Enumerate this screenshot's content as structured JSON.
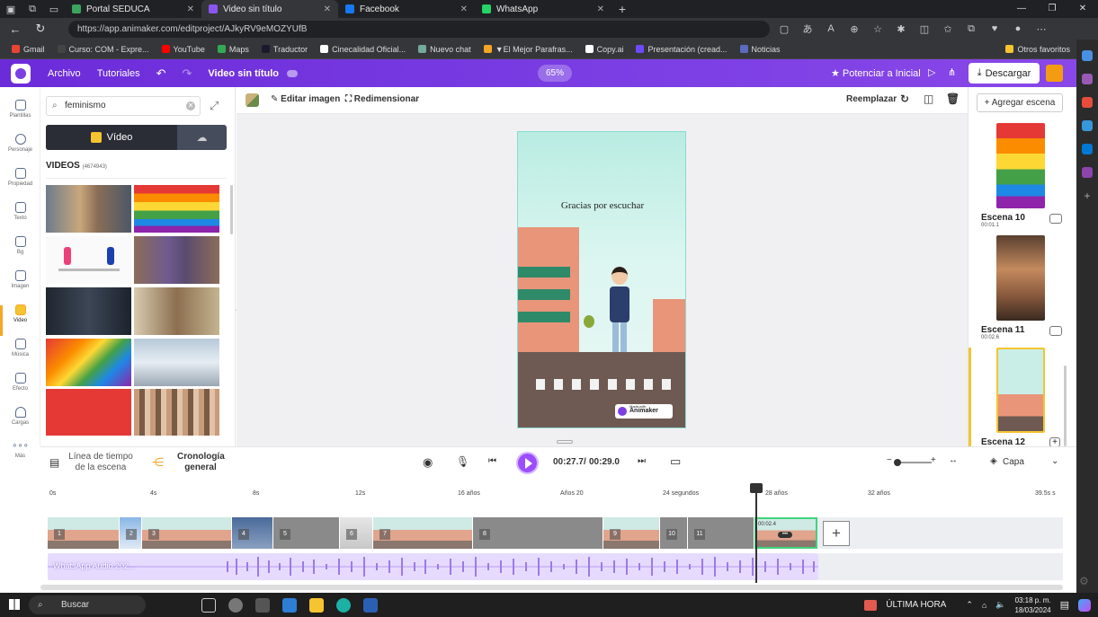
{
  "browser": {
    "tabs": [
      {
        "label": "Portal SEDUCA",
        "color": "#3aa55d"
      },
      {
        "label": "Video sin título",
        "color": "#8b55f0"
      },
      {
        "label": "Facebook",
        "color": "#1877f2"
      },
      {
        "label": "WhatsApp",
        "color": "#25d366"
      }
    ],
    "url": "https://app.animaker.com/editproject/AJkyRV9eMOZYUfB",
    "window_controls": {
      "minimize": "—",
      "maximize": "❐",
      "close": "✕"
    }
  },
  "bookmarks": [
    {
      "label": "Gmail",
      "color": "#ea4335"
    },
    {
      "label": "Curso: COM - Expre...",
      "color": "#444444"
    },
    {
      "label": "YouTube",
      "color": "#ff0000"
    },
    {
      "label": "Maps",
      "color": "#34a853"
    },
    {
      "label": "Traductor",
      "color": "#1a1a2e"
    },
    {
      "label": "Cinecalidad Oficial...",
      "color": "#ffffff"
    },
    {
      "label": "Nuevo chat",
      "color": "#74aa9c"
    },
    {
      "label": "▼El Mejor Parafras...",
      "color": "#f5a623"
    },
    {
      "label": "Copy.ai",
      "color": "#ffffff"
    },
    {
      "label": "Presentación (cread...",
      "color": "#6d4aff"
    },
    {
      "label": "Noticias",
      "color": "#5c6bc0"
    },
    {
      "label": "Otros favoritos",
      "color": "#f5c430"
    }
  ],
  "topbar": {
    "archivo": "Archivo",
    "tutoriales": "Tutoriales",
    "undo": "↶",
    "redo": "↷",
    "title": "Video sin título",
    "zoom": "65%",
    "power_up": "★ Potenciar a Inicial",
    "download": "Descargar"
  },
  "rail": [
    {
      "label": "Plantillas",
      "active": false
    },
    {
      "label": "Personaje",
      "active": false
    },
    {
      "label": "Propiedad",
      "active": false
    },
    {
      "label": "Texto",
      "active": false
    },
    {
      "label": "Bg",
      "active": false
    },
    {
      "label": "Imagen",
      "active": false
    },
    {
      "label": "Video",
      "active": true
    },
    {
      "label": "Música",
      "active": false
    },
    {
      "label": "Efecto",
      "active": false
    },
    {
      "label": "Cargas",
      "active": false
    },
    {
      "label": "Más",
      "active": false
    }
  ],
  "panel": {
    "search_value": "feminismo",
    "toggle_video": "Vídeo",
    "videos_title": "VIDEOS",
    "videos_count": "(4674943)"
  },
  "canvas": {
    "edit_image": "Editar imagen",
    "resize": "Redimensionar",
    "replace": "Reemplazar",
    "scene_text": "Gracias por escuchar",
    "watermark_small": "Made with",
    "watermark": "Animaker"
  },
  "scenes": {
    "add_scene": "+ Agregar escena",
    "list": [
      {
        "label": "Escena 10",
        "time": "00:01.1"
      },
      {
        "label": "Escena 11",
        "time": "00:02.6"
      },
      {
        "label": "Escena 12",
        "time": ""
      }
    ]
  },
  "timeline": {
    "scene_timeline": "Línea de tiempo de la escena",
    "general_timeline": "Cronología general",
    "current_time": "00:27.7",
    "separator": "/",
    "total_time": "00:29.0",
    "layer": "Capa",
    "ruler": [
      "0s",
      "4s",
      "8s",
      "12s",
      "16 años",
      "Años 20",
      "24 segundos",
      "28 años",
      "32 años",
      "39.5s s"
    ],
    "segments": [
      "1",
      "2",
      "3",
      "4",
      "5",
      "6",
      "7",
      "8",
      "9",
      "10",
      "11",
      ""
    ],
    "active_segment_time": "00:02.4",
    "audio_label": "WhatsApp Audio 202..."
  },
  "taskbar": {
    "search": "Buscar",
    "news": "ÚLTIMA HORA",
    "clock": "03:18 p. m.",
    "date": "18/03/2024"
  }
}
